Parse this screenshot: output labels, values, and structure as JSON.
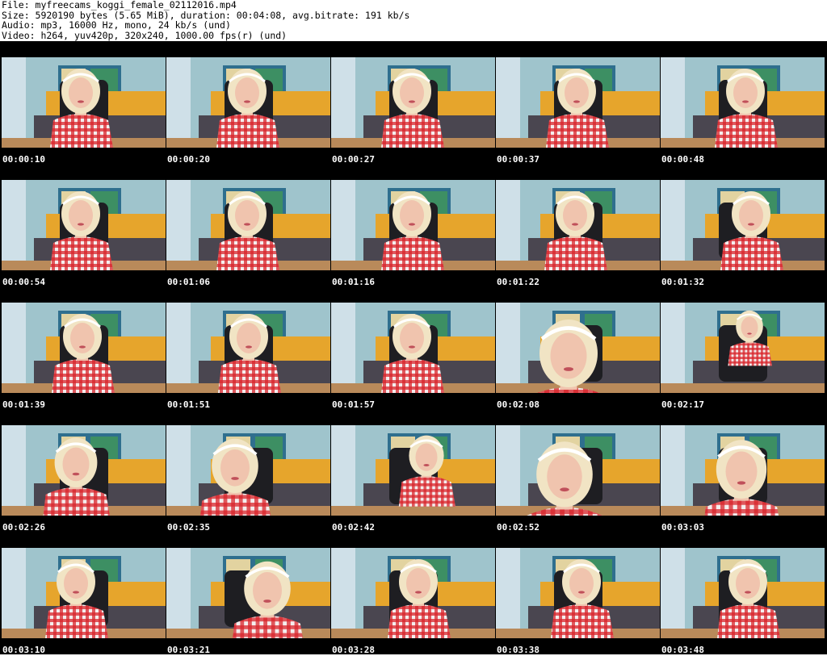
{
  "header": {
    "lines": [
      "File: myfreecams_koggi_female_02112016.mp4",
      "Size: 5920190 bytes (5.65 MiB), duration: 00:04:08, avg.bitrate: 191 kb/s",
      "Audio: mp3, 16000 Hz, mono, 24 kb/s (und)",
      "Video: h264, yuv420p, 320x240, 1000.00 fps(r) (und)"
    ]
  },
  "thumbnails": [
    {
      "time": "00:00:10"
    },
    {
      "time": "00:00:20"
    },
    {
      "time": "00:00:27"
    },
    {
      "time": "00:00:37"
    },
    {
      "time": "00:00:48"
    },
    {
      "time": "00:00:54"
    },
    {
      "time": "00:01:06"
    },
    {
      "time": "00:01:16"
    },
    {
      "time": "00:01:22"
    },
    {
      "time": "00:01:32"
    },
    {
      "time": "00:01:39"
    },
    {
      "time": "00:01:51"
    },
    {
      "time": "00:01:57"
    },
    {
      "time": "00:02:08"
    },
    {
      "time": "00:02:17"
    },
    {
      "time": "00:02:26"
    },
    {
      "time": "00:02:35"
    },
    {
      "time": "00:02:42"
    },
    {
      "time": "00:02:52"
    },
    {
      "time": "00:03:03"
    },
    {
      "time": "00:03:10"
    },
    {
      "time": "00:03:21"
    },
    {
      "time": "00:03:28"
    },
    {
      "time": "00:03:38"
    },
    {
      "time": "00:03:48"
    }
  ],
  "colors": {
    "wall": "#9fc4cc",
    "curtain": "#cfe0e8",
    "sofa": "#e6a52c",
    "sofa_seat": "#4a4650",
    "chair": "#1e1e22",
    "dress_red": "#d8242a",
    "dress_white": "#f4eeee",
    "hair": "#f1e4c4",
    "skin": "#f0c4ae",
    "floor": "#b98a5a"
  }
}
